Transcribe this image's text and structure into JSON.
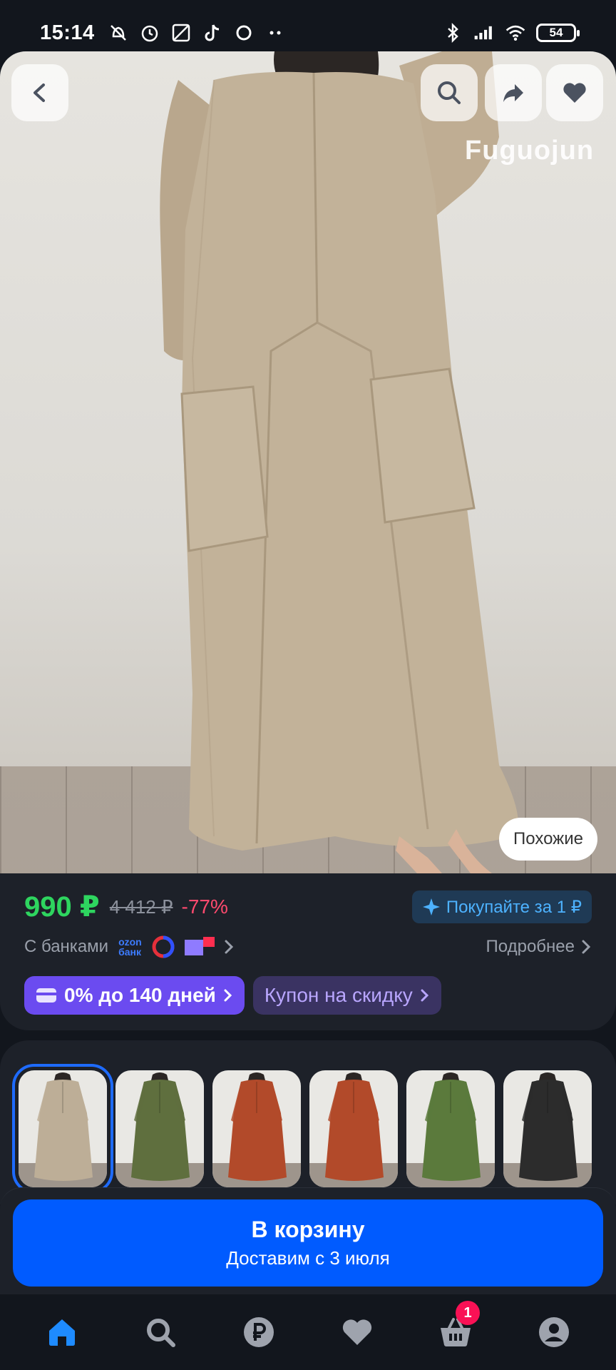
{
  "status_bar": {
    "time": "15:14",
    "battery": "54"
  },
  "hero": {
    "watermark": "Fuguojun",
    "similar_label": "Похожие"
  },
  "price": {
    "current": "990 ₽",
    "old": "4 412 ₽",
    "discount": "-77%",
    "buy_for": "Покупайте за 1 ₽",
    "banks_label": "С банками",
    "ozon_bank_line1": "ozon",
    "ozon_bank_line2": "банк",
    "more_label": "Подробнее",
    "credit_chip": "0% до 140 дней",
    "coupon_chip": "Купон на скидку"
  },
  "variants": [
    {
      "color": "#bdae97",
      "selected": true
    },
    {
      "color": "#5f6f3e"
    },
    {
      "color": "#b24a2a"
    },
    {
      "color": "#b24a2a"
    },
    {
      "color": "#5b7a3c"
    },
    {
      "color": "#2c2c2c"
    }
  ],
  "cart": {
    "title": "В корзину",
    "subtitle": "Доставим с 3 июля"
  },
  "bottom_nav": {
    "cart_badge": "1"
  },
  "colors": {
    "accent_blue": "#005bff",
    "price_green": "#2ed55f",
    "discount_pink": "#ff4a6e"
  }
}
